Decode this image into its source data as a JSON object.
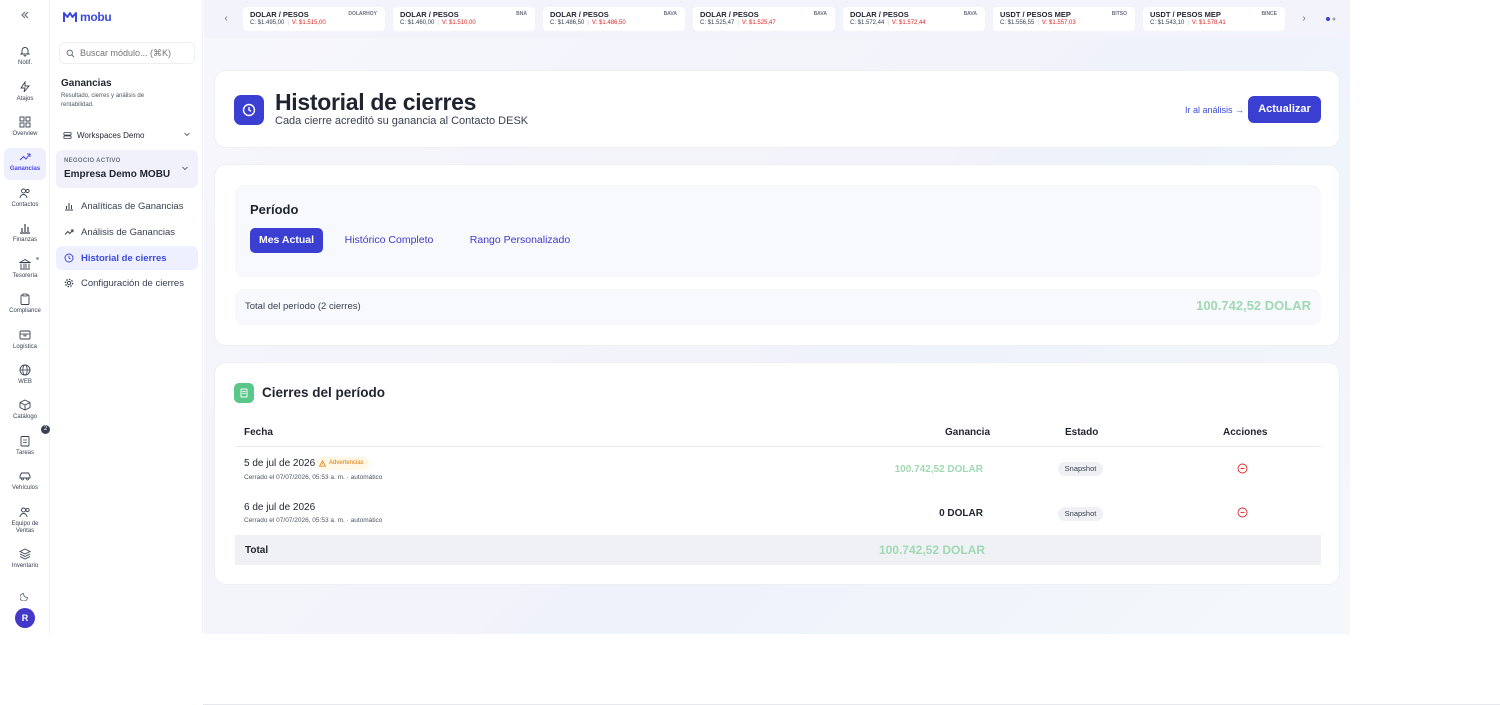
{
  "colors": {
    "brand": "#3b3fd1",
    "accent_text": "#3b4bd8",
    "positive": "#9fd9b3",
    "positive_strong": "#5ac78a",
    "negative": "#dc2626",
    "warning": "#d97706"
  },
  "rail": {
    "collapse_icon": "double-chevron-left-icon",
    "items": [
      {
        "label": "Notif.",
        "icon": "bell-icon"
      },
      {
        "label": "Atajos",
        "icon": "shortcut-icon"
      },
      {
        "label": "Overview",
        "icon": "grid-icon"
      },
      {
        "label": "Ganancias",
        "icon": "trending-up-icon",
        "active": true
      },
      {
        "label": "Contactos",
        "icon": "users-icon"
      },
      {
        "label": "Finanzas",
        "icon": "bar-chart-icon"
      },
      {
        "label": "Tesorería",
        "icon": "bank-icon"
      },
      {
        "label": "Compliance",
        "icon": "clipboard-icon"
      },
      {
        "label": "Logística",
        "icon": "box-icon"
      },
      {
        "label": "WEB",
        "icon": "globe-icon"
      },
      {
        "label": "Catálogo",
        "icon": "cube-icon",
        "badge": "2"
      },
      {
        "label": "Tareas",
        "icon": "checklist-icon"
      },
      {
        "label": "Vehículos",
        "icon": "car-icon"
      },
      {
        "label": "Equipo de Ventas",
        "icon": "team-icon"
      },
      {
        "label": "Inventario",
        "icon": "stack-icon"
      }
    ],
    "theme_icon": "moon-icon",
    "avatar_initial": "R"
  },
  "panel": {
    "logo": "mobu",
    "search_placeholder": "Buscar módulo... (⌘K)",
    "section_title": "Ganancias",
    "section_desc": "Resultado, cierres y análisis de rentabilidad.",
    "workspace": "Workspaces Demo",
    "business_kicker": "NEGOCIO ACTIVO",
    "business_name": "Empresa Demo MOBU",
    "nav": [
      {
        "label": "Analíticas de Ganancias",
        "icon": "bar-chart-icon"
      },
      {
        "label": "Análisis de Ganancias",
        "icon": "trending-up-icon"
      },
      {
        "label": "Historial de cierres",
        "icon": "clock-icon",
        "active": true
      },
      {
        "label": "Configuración de cierres",
        "icon": "gear-icon"
      }
    ]
  },
  "ticker": [
    {
      "pair": "DOLAR / PESOS",
      "source": "DOLARHOY",
      "compra": "C: $1.495,00",
      "venta": "V: $1.515,00"
    },
    {
      "pair": "DOLAR / PESOS",
      "source": "BNA",
      "compra": "C: $1.460,00",
      "venta": "V: $1.510,00"
    },
    {
      "pair": "DOLAR / PESOS",
      "source": "BAVA",
      "compra": "C: $1.486,50",
      "venta": "V: $1.486,50"
    },
    {
      "pair": "DOLAR / PESOS",
      "source": "BAVA",
      "compra": "C: $1.525,47",
      "venta": "V: $1.525,47"
    },
    {
      "pair": "DOLAR / PESOS",
      "source": "BAVA",
      "compra": "C: $1.572,44",
      "venta": "V: $1.572,44"
    },
    {
      "pair": "USDT / PESOS MEP",
      "source": "BITSO",
      "compra": "C: $1.556,55",
      "venta": "V: $1.557,03"
    },
    {
      "pair": "USDT / PESOS MEP",
      "source": "BINCE",
      "compra": "C: $1.543,10",
      "venta": "V: $1.578,41"
    }
  ],
  "header": {
    "title": "Historial de cierres",
    "subtitle": "Cada cierre acreditó su ganancia al Contacto DESK",
    "analysis_link": "Ir al análisis →",
    "refresh_button": "Actualizar"
  },
  "period": {
    "title": "Período",
    "options": [
      "Mes Actual",
      "Histórico Completo",
      "Rango Personalizado"
    ],
    "selected": "Mes Actual",
    "total_label": "Total del período (2 cierres)",
    "total_amount": "100.742,52 DOLAR"
  },
  "closings": {
    "title": "Cierres del período",
    "columns": {
      "date": "Fecha",
      "profit": "Ganancia",
      "status": "Estado",
      "actions": "Acciones"
    },
    "rows": [
      {
        "date": "5 de jul de 2026",
        "warning": "Advertencias",
        "closed": "Cerrado el 07/07/2026, 05:53 a. m. · automático",
        "amount": "100.742,52 DOLAR",
        "status": "Snapshot"
      },
      {
        "date": "6 de jul de 2026",
        "warning": "",
        "closed": "Cerrado el 07/07/2026, 05:53 a. m. · automático",
        "amount": "0 DOLAR",
        "status": "Snapshot"
      }
    ],
    "total_label": "Total",
    "total_amount": "100.742,52 DOLAR"
  }
}
